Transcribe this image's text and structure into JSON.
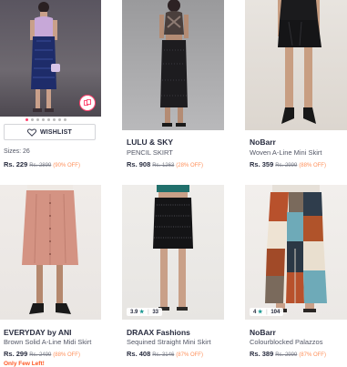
{
  "products": [
    {
      "brand": "",
      "name": "",
      "price": "Rs. 229",
      "mrp": "Rs. 2899",
      "discount": "(90% OFF)",
      "sizes": "Sizes: 26",
      "wishlist_label": "WISHLIST"
    },
    {
      "brand": "LULU & SKY",
      "name": "PENCIL SKIRT",
      "price": "Rs. 908",
      "mrp": "Rs. 1263",
      "discount": "(28% OFF)"
    },
    {
      "brand": "NoBarr",
      "name": "Woven A-Line Mini Skirt",
      "price": "Rs. 359",
      "mrp": "Rs. 2999",
      "discount": "(88% OFF)"
    },
    {
      "brand": "EVERYDAY by ANI",
      "name": "Brown Solid A-Line Midi Skirt",
      "price": "Rs. 299",
      "mrp": "Rs. 2499",
      "discount": "(88% OFF)",
      "stock_note": "Only Few Left!"
    },
    {
      "brand": "DRAAX Fashions",
      "name": "Sequined Straight Mini Skirt",
      "price": "Rs. 408",
      "mrp": "Rs. 3146",
      "discount": "(87% OFF)",
      "rating": "3.9",
      "rating_count": "33"
    },
    {
      "brand": "NoBarr",
      "name": "Colourblocked Palazzos",
      "price": "Rs. 389",
      "mrp": "Rs. 2999",
      "discount": "(87% OFF)",
      "rating": "4",
      "rating_count": "104"
    }
  ],
  "colors": {
    "accent": "#ff3f6c",
    "discount": "#ff905a",
    "star": "#14958f"
  }
}
